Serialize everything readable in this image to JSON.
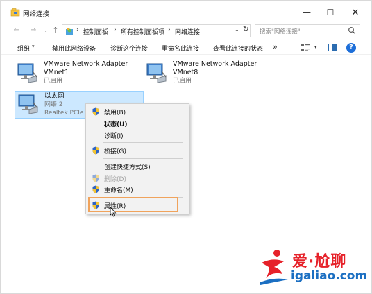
{
  "window": {
    "title": "网络连接"
  },
  "window_controls": {
    "minimize": "—",
    "maximize": "☐",
    "close": "✕"
  },
  "address": {
    "back": "←",
    "forward": "→",
    "recent": "⌄",
    "up": "↑",
    "breadcrumbs": [
      "控制面板",
      "所有控制面板项",
      "网络连接"
    ],
    "separator": "›",
    "dropdown": "⌄",
    "refresh": "↻"
  },
  "search": {
    "placeholder": "搜索\"网络连接\""
  },
  "toolbar": {
    "organize": "组织",
    "organize_caret": "▾",
    "disable_device": "禁用此网络设备",
    "diagnose": "诊断这个连接",
    "rename": "重命名此连接",
    "view_status": "查看此连接的状态",
    "more": "»",
    "view_caret": "▾"
  },
  "adapters": [
    {
      "name": "VMware Network Adapter",
      "sub": "VMnet1",
      "status": "已启用",
      "selected": false
    },
    {
      "name": "VMware Network Adapter",
      "sub": "VMnet8",
      "status": "已启用",
      "selected": false
    },
    {
      "name": "以太网",
      "sub": "网络 2",
      "status": "Realtek PCIe G",
      "selected": true
    }
  ],
  "context_menu": {
    "items": [
      {
        "label": "禁用(B)",
        "shield": true
      },
      {
        "label": "状态(U)",
        "bold": true
      },
      {
        "label": "诊断(I)"
      },
      {
        "label": "桥接(G)",
        "shield": true
      },
      {
        "label": "创建快捷方式(S)"
      },
      {
        "label": "删除(D)",
        "shield": true,
        "disabled": true
      },
      {
        "label": "重命名(M)",
        "shield": true
      },
      {
        "label": "属性(R)",
        "shield": true,
        "highlighted": true
      }
    ]
  },
  "watermark": {
    "cn": "爱·尬聊",
    "en": "igaliao.com"
  },
  "colors": {
    "selection_bg": "#cce8ff",
    "highlight_border": "#f0a35c",
    "help_blue": "#1e6fd9",
    "watermark_red": "#e62129",
    "watermark_blue": "#1b6fc2"
  }
}
